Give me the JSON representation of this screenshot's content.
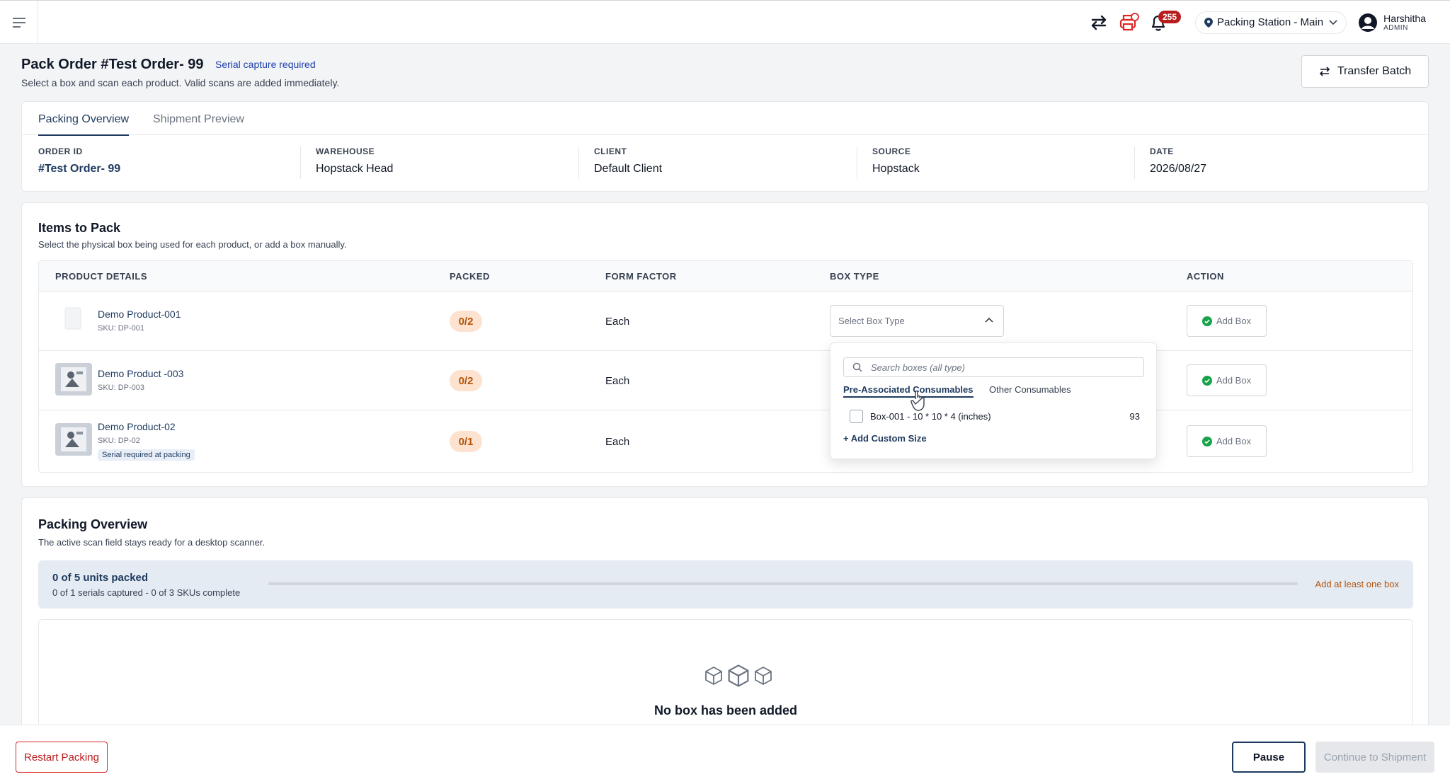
{
  "topbar": {
    "notifications_count": "255",
    "station_label": "Packing Station - Main",
    "user_name": "Harshitha",
    "user_role": "ADMIN"
  },
  "header": {
    "title": "Pack Order #Test Order- 99",
    "serial_tag": "Serial capture required",
    "subtitle": "Select a box and scan each product. Valid scans are added immediately.",
    "transfer_label": "Transfer Batch"
  },
  "order": {
    "tabs": [
      {
        "label": "Packing Overview",
        "active": true
      },
      {
        "label": "Shipment Preview",
        "active": false
      }
    ],
    "fields": [
      {
        "label": "ORDER ID",
        "value": "#Test Order- 99"
      },
      {
        "label": "WAREHOUSE",
        "value": "Hopstack Head"
      },
      {
        "label": "CLIENT",
        "value": "Default Client"
      },
      {
        "label": "SOURCE",
        "value": "Hopstack"
      },
      {
        "label": "DATE",
        "value": "2026/08/27"
      }
    ]
  },
  "items": {
    "title": "Items to Pack",
    "subtitle": "Select the physical box being used for each product, or add a box manually.",
    "columns": [
      "PRODUCT DETAILS",
      "PACKED",
      "FORM FACTOR",
      "BOX TYPE",
      "ACTION"
    ],
    "rows": [
      {
        "name": "Demo Product-001",
        "sku": "SKU: DP-001",
        "packed": "0/2",
        "form_factor": "Each",
        "action": "Add Box"
      },
      {
        "name": "Demo Product -003",
        "sku": "SKU: DP-003",
        "packed": "0/2",
        "form_factor": "Each",
        "action": "Add Box"
      },
      {
        "name": "Demo Product-02",
        "sku": "SKU: DP-02",
        "tag": "Serial required at packing",
        "packed": "0/1",
        "form_factor": "Each",
        "action": "Add Box"
      }
    ],
    "box_select_placeholder": "Select Box Type"
  },
  "dropdown": {
    "search_placeholder": "Search boxes (all type)",
    "tabs": [
      {
        "label": "Pre-Associated Consumables",
        "active": true
      },
      {
        "label": "Other Consumables",
        "active": false
      }
    ],
    "options": [
      {
        "label": "Box-001 - 10 * 10 * 4 (inches)",
        "count": "93"
      }
    ],
    "add_custom_label": "+ Add Custom Size"
  },
  "overview": {
    "title": "Packing Overview",
    "subtitle": "The active scan field stays ready for a desktop scanner.",
    "progress_title": "0 of 5 units packed",
    "progress_sub": "0 of 1 serials captured - 0 of 3 SKUs complete",
    "progress_fraction": 0,
    "warning": "Add at least one box",
    "empty_title": "No box has been added"
  },
  "footer": {
    "restart_label": "Restart Packing",
    "pause_label": "Pause",
    "continue_label": "Continue to Shipment"
  },
  "colors": {
    "primary": "#1e3a5f",
    "warning": "#b45309",
    "danger": "#b91c1c",
    "success": "#16a34a"
  }
}
